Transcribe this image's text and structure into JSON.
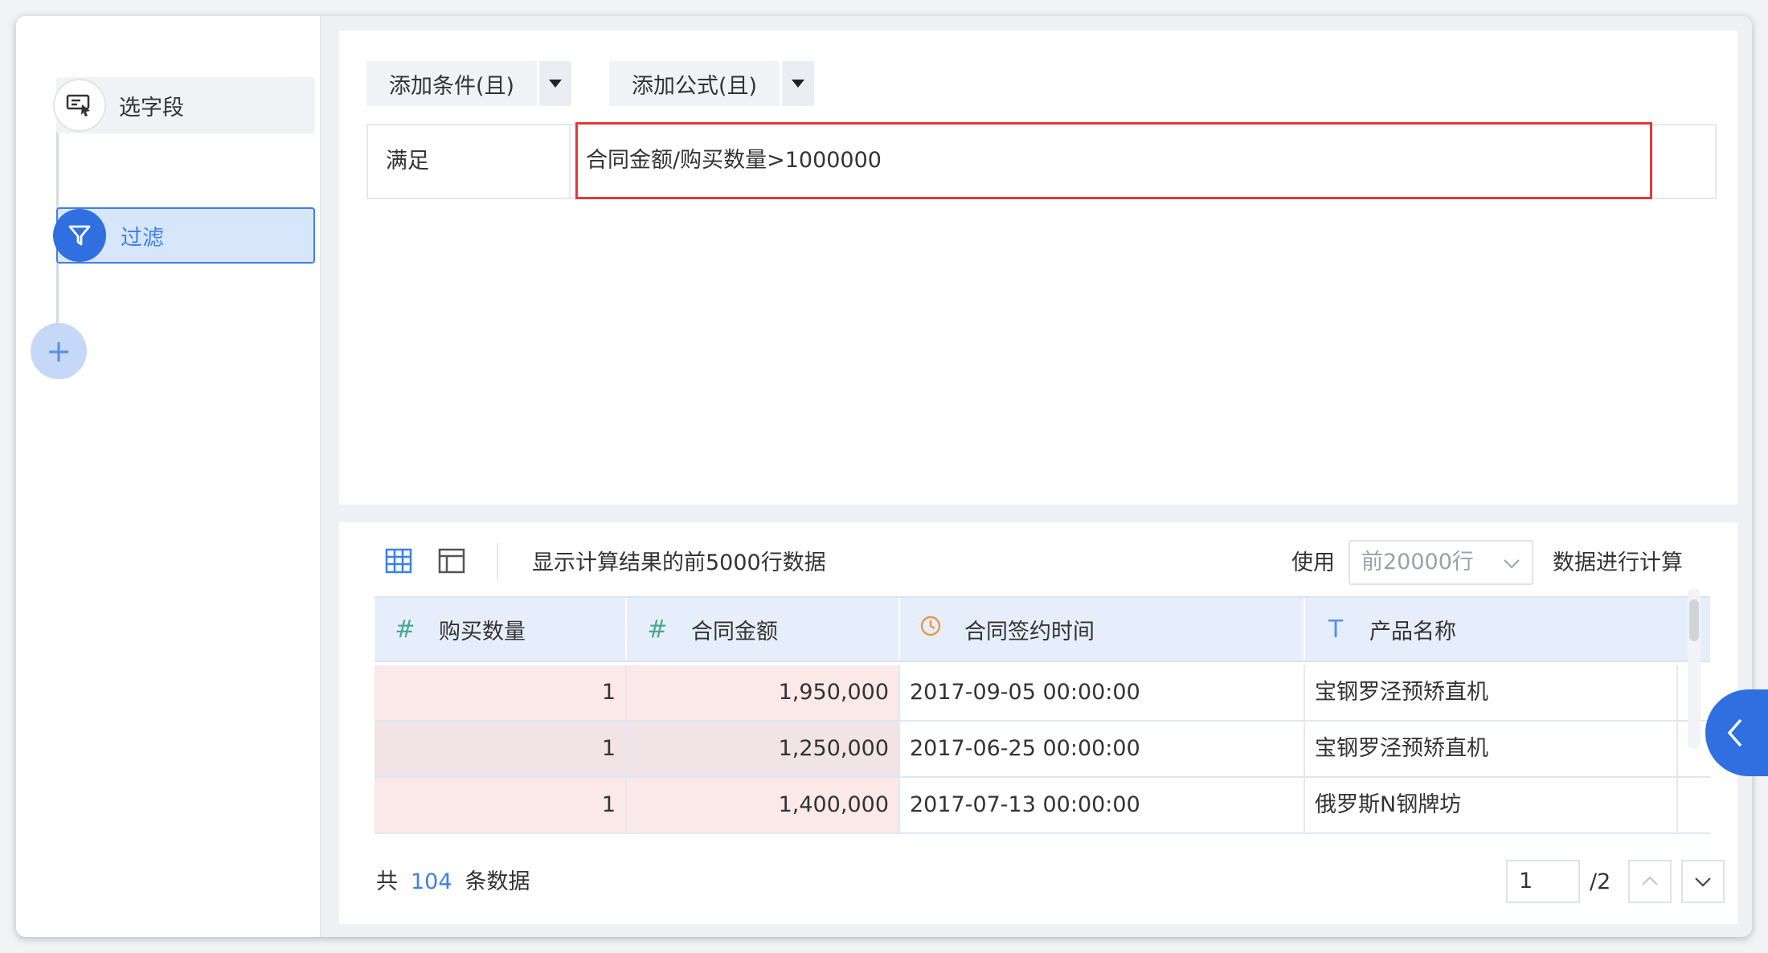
{
  "sidebar": {
    "steps": [
      {
        "label": "选字段",
        "icon": "field-select-icon"
      },
      {
        "label": "过滤",
        "icon": "filter-icon",
        "active": true
      },
      {
        "label": "+",
        "icon": "plus-icon"
      }
    ]
  },
  "filter_panel": {
    "add_condition_label": "添加条件(且)",
    "add_formula_label": "添加公式(且)",
    "satisfy_label": "满足",
    "formula": "合同金额/购买数量>1000000"
  },
  "data_preview": {
    "info_text": "显示计算结果的前5000行数据",
    "use_label": "使用",
    "rows_select_value": "前20000行",
    "calc_label": "数据进行计算",
    "columns": [
      {
        "type_icon": "#",
        "label": "购买数量"
      },
      {
        "type_icon": "#",
        "label": "合同金额"
      },
      {
        "type_icon": "clock",
        "label": "合同签约时间"
      },
      {
        "type_icon": "T",
        "label": "产品名称"
      }
    ],
    "rows": [
      {
        "qty": "1",
        "amount": "1,950,000",
        "time": "2017-09-05 00:00:00",
        "product": "宝钢罗泾预矫直机"
      },
      {
        "qty": "1",
        "amount": "1,250,000",
        "time": "2017-06-25 00:00:00",
        "product": "宝钢罗泾预矫直机"
      },
      {
        "qty": "1",
        "amount": "1,400,000",
        "time": "2017-07-13 00:00:00",
        "product": "俄罗斯N钢牌坊"
      }
    ],
    "footer": {
      "total_prefix": "共",
      "total_count": "104",
      "total_suffix": "条数据",
      "current_page": "1",
      "total_pages": "/2"
    }
  },
  "colors": {
    "accent": "#2f6fe0",
    "highlight_border": "#e0393b",
    "numeric_cell_bg": "#fbe8e8",
    "header_bg": "#e7eefb"
  }
}
